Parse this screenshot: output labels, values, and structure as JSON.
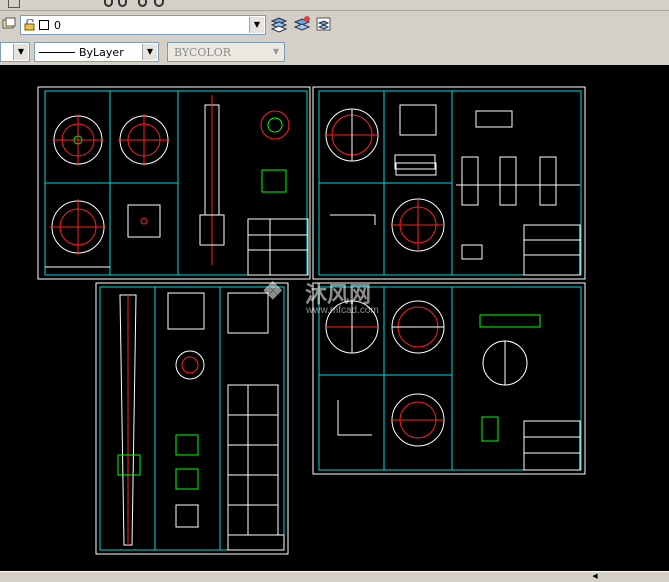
{
  "layer_toolbar": {
    "current_layer": "0"
  },
  "properties_toolbar": {
    "linetype": "ByLayer",
    "color": "BYCOLOR"
  },
  "watermark": {
    "cn": "沐风网",
    "url": "www.mfcad.com"
  },
  "colors": {
    "frame": "#00d8d8",
    "sheet_border": "#ffffff",
    "red_lines": "#ff2020",
    "green_lines": "#00ff00",
    "toolbar_bg": "#d4d0c8"
  },
  "icons": [
    "layer-manager-icon",
    "layer-lock-icon",
    "layer-color-swatch-icon",
    "layer-previous-icon",
    "layer-states-icon",
    "layer-isolate-icon",
    "color-dropdown-icon"
  ]
}
